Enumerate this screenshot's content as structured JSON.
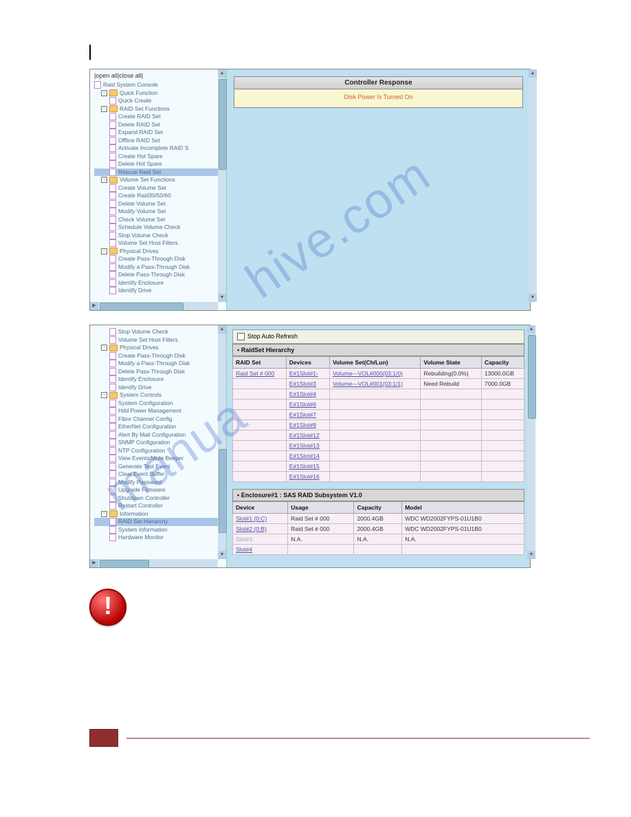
{
  "watermark_a": "hive.com",
  "watermark_b": "manua",
  "screenshot1": {
    "tree_top": "|open all|close all|",
    "root": "Raid System Console",
    "groups": [
      {
        "label": "Quick Function",
        "items": [
          "Quick Create"
        ]
      },
      {
        "label": "RAID Set Functions",
        "items": [
          "Create RAID Set",
          "Delete RAID Set",
          "Expand RAID Set",
          "Offline RAID Set",
          "Activate Incomplete RAID S",
          "Create Hot Spare",
          "Delete Hot Spare",
          "Rescue Raid Set"
        ]
      },
      {
        "label": "Volume Set Functions",
        "items": [
          "Create Volume Set",
          "Create Raid30/50/60",
          "Delete Volume Set",
          "Modify Volume Set",
          "Check Volume Set",
          "Schedule Volume Check",
          "Stop Volume Check",
          "Volume Set Host Filters"
        ]
      },
      {
        "label": "Physical Drives",
        "items": [
          "Create Pass-Through Disk",
          "Modify a Pass-Through Disk",
          "Delete Pass-Through Disk",
          "Identify Enclosure",
          "Identify Drive"
        ]
      }
    ],
    "highlight": "Rescue Raid Set",
    "panel_title": "Controller Response",
    "panel_msg": "Disk Power Is Turned On"
  },
  "screenshot2": {
    "tree_pre": [
      "Stop Volume Check",
      "Volume Set Host Filters"
    ],
    "groups": [
      {
        "label": "Physical Drives",
        "items": [
          "Create Pass-Through Disk",
          "Modify a Pass-Through Disk",
          "Delete Pass-Through Disk",
          "Identify Enclosure",
          "Identify Drive"
        ]
      },
      {
        "label": "System Controls",
        "items": [
          "System Configuration",
          "Hdd Power Management",
          "Fibre Channel Config",
          "EtherNet Configuration",
          "Alert By Mail Configuration",
          "SNMP Configuration",
          "NTP Configuration",
          "View Events/Mute Beeper",
          "Generate Test Event",
          "Clear Event Buffer",
          "Modify Password",
          "Upgrade Firmware",
          "Shutdown Controller",
          "Restart Controller"
        ]
      },
      {
        "label": "Information",
        "items": [
          "RAID Set Hierarchy",
          "System Information",
          "Hardware Monitor"
        ]
      }
    ],
    "highlight": "RAID Set Hierarchy",
    "stop_auto_refresh": "Stop Auto Refresh",
    "hierarchy_title": "RaidSet Hierarchy",
    "cols": [
      "RAID Set",
      "Devices",
      "Volume Set(Ch/Lun)",
      "Volume State",
      "Capacity"
    ],
    "rows": [
      {
        "raid": "Raid Set # 000",
        "dev": "E#1Slot#1-",
        "vol": "Volume---VOL#000(03:1/0)",
        "state": "Rebuilding(0.0%)",
        "state_class": "red",
        "cap": "13000.0GB"
      },
      {
        "raid": "",
        "dev": "E#1Slot#3",
        "vol": "Volume---VOL#001(03:1/1)",
        "state": "Need Rebuild",
        "state_class": "red",
        "cap": "7000.0GB"
      },
      {
        "raid": "",
        "dev": "E#1Slot#4",
        "vol": "",
        "state": "",
        "state_class": "",
        "cap": ""
      },
      {
        "raid": "",
        "dev": "E#1Slot#6",
        "vol": "",
        "state": "",
        "state_class": "",
        "cap": ""
      },
      {
        "raid": "",
        "dev": "E#1Slot#7",
        "vol": "",
        "state": "",
        "state_class": "",
        "cap": ""
      },
      {
        "raid": "",
        "dev": "E#1Slot#9",
        "vol": "",
        "state": "",
        "state_class": "",
        "cap": ""
      },
      {
        "raid": "",
        "dev": "E#1Slot#12",
        "vol": "",
        "state": "",
        "state_class": "",
        "cap": ""
      },
      {
        "raid": "",
        "dev": "E#1Slot#13",
        "vol": "",
        "state": "",
        "state_class": "",
        "cap": ""
      },
      {
        "raid": "",
        "dev": "E#1Slot#14",
        "vol": "",
        "state": "",
        "state_class": "",
        "cap": ""
      },
      {
        "raid": "",
        "dev": "E#1Slot#15",
        "vol": "",
        "state": "",
        "state_class": "",
        "cap": ""
      },
      {
        "raid": "",
        "dev": "E#1Slot#16",
        "vol": "",
        "state": "",
        "state_class": "",
        "cap": ""
      }
    ],
    "enclosure_title": "Enclosure#1 : SAS RAID Subsystem V1.0",
    "enc_cols": [
      "Device",
      "Usage",
      "Capacity",
      "Model"
    ],
    "enc_rows": [
      {
        "d": "Slot#1 (0:C)",
        "u": "Raid Set # 000",
        "c": "2000.4GB",
        "m": "WDC WD2002FYPS-01U1B0"
      },
      {
        "d": "Slot#2 (0:B)",
        "u": "Raid Set # 000",
        "c": "2000.4GB",
        "m": "WDC WD2002FYPS-01U1B0"
      },
      {
        "d": "Slot#3",
        "u": "N.A.",
        "c": "N.A.",
        "m": "N.A.",
        "gray": true
      },
      {
        "d": "Slot#4",
        "u": "",
        "c": "",
        "m": ""
      }
    ]
  },
  "warn_glyph": "!"
}
